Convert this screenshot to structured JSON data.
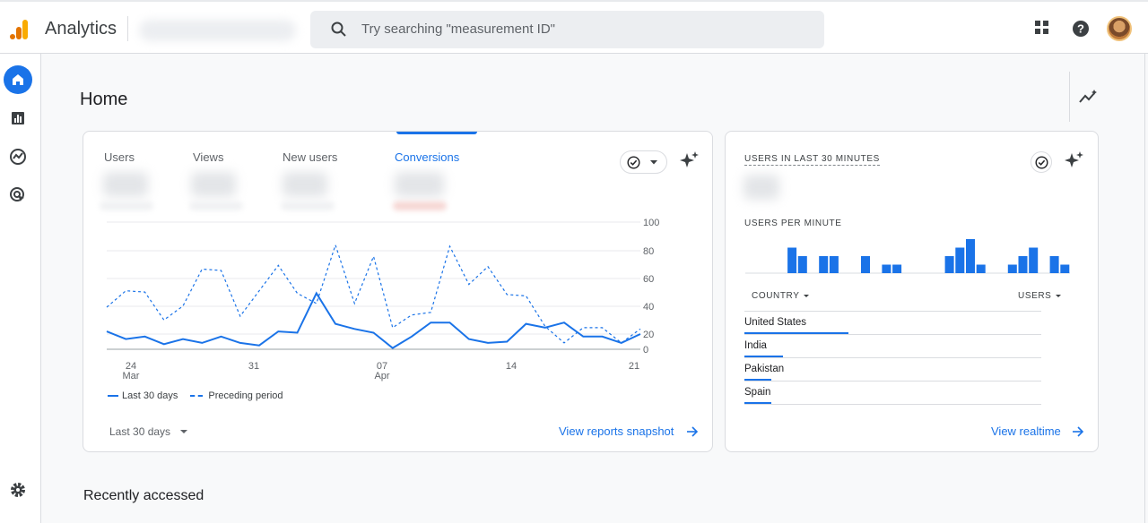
{
  "app": {
    "name": "Analytics"
  },
  "search": {
    "placeholder": "Try searching \"measurement ID\""
  },
  "page": {
    "title": "Home",
    "recently_accessed": "Recently accessed"
  },
  "metrics_card": {
    "tabs": [
      {
        "label": "Users"
      },
      {
        "label": "Views"
      },
      {
        "label": "New users"
      },
      {
        "label": "Conversions",
        "active": true
      }
    ],
    "legend": {
      "current": "Last 30 days",
      "previous": "Preceding period"
    },
    "date_range": "Last 30 days",
    "link": "View reports snapshot",
    "icons": [
      "check-circle-icon",
      "chevron-down-icon",
      "sparkle-icon",
      "arrow-right-icon"
    ]
  },
  "chart_data": {
    "type": "line",
    "x_tick_labels": [
      {
        "day": "24",
        "month": "Mar"
      },
      {
        "day": "31",
        "month": ""
      },
      {
        "day": "07",
        "month": "Apr"
      },
      {
        "day": "14",
        "month": ""
      },
      {
        "day": "21",
        "month": ""
      }
    ],
    "y_ticks": [
      0,
      20,
      40,
      60,
      80,
      100
    ],
    "ylim": [
      0,
      100
    ],
    "series": [
      {
        "name": "Last 30 days",
        "style": "solid",
        "color": "#1a73e8",
        "values": [
          14,
          8,
          10,
          4,
          8,
          5,
          10,
          5,
          3,
          14,
          13,
          44,
          20,
          16,
          13,
          1,
          10,
          21,
          21,
          8,
          5,
          6,
          20,
          17,
          21,
          10,
          10,
          5,
          12
        ]
      },
      {
        "name": "Preceding period",
        "style": "dashed",
        "color": "#1a73e8",
        "values": [
          33,
          46,
          45,
          23,
          34,
          63,
          62,
          26,
          46,
          66,
          44,
          36,
          82,
          36,
          73,
          17,
          27,
          29,
          81,
          51,
          65,
          43,
          42,
          18,
          5,
          17,
          17,
          5,
          16
        ]
      }
    ]
  },
  "realtime_card": {
    "title": "USERS IN LAST 30 MINUTES",
    "subtitle": "USERS PER MINUTE",
    "bars": [
      0,
      0,
      0,
      3,
      2,
      0,
      2,
      2,
      0,
      0,
      2,
      0,
      1,
      1,
      0,
      0,
      0,
      0,
      2,
      3,
      4,
      1,
      0,
      0,
      1,
      2,
      3,
      0,
      2,
      1,
      0,
      1
    ],
    "col_country": "COUNTRY",
    "col_users": "USERS",
    "countries": [
      {
        "name": "United States",
        "share": 0.35
      },
      {
        "name": "India",
        "share": 0.13
      },
      {
        "name": "Pakistan",
        "share": 0.09
      },
      {
        "name": "Spain",
        "share": 0.09
      }
    ],
    "link": "View realtime",
    "accent": "#1a73e8"
  },
  "colors": {
    "accent": "#1a73e8",
    "logo_orange": "#f9ab00",
    "logo_dark_orange": "#e37400"
  }
}
